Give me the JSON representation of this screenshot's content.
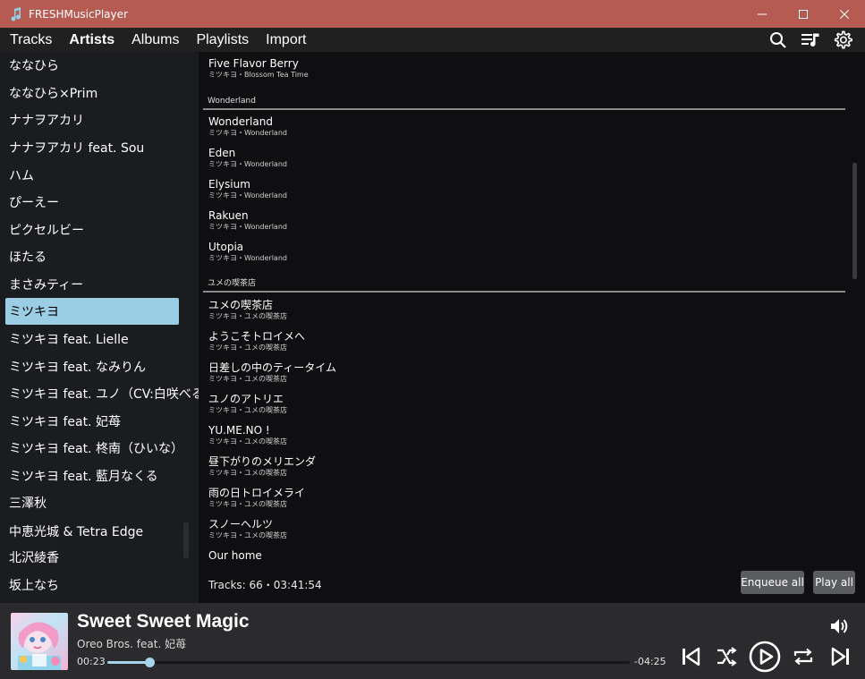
{
  "window": {
    "title": "FRESHMusicPlayer"
  },
  "nav": {
    "tabs": [
      {
        "label": "Tracks"
      },
      {
        "label": "Artists"
      },
      {
        "label": "Albums"
      },
      {
        "label": "Playlists"
      },
      {
        "label": "Import"
      }
    ],
    "active_tab": "Artists",
    "icons": [
      "search-icon",
      "queue-icon",
      "settings-icon"
    ]
  },
  "sidebar": {
    "artists": [
      "ななひら",
      "ななひら×Prim",
      "ナナヲアカリ",
      "ナナヲアカリ feat. Sou",
      "ハム",
      "ぴーえー",
      "ピクセルビー",
      "ほたる",
      "まさみティー",
      "ミツキヨ",
      "ミツキヨ feat. Lielle",
      "ミツキヨ feat. なみりん",
      "ミツキヨ feat. ユノ（CV:白咲べる）",
      "ミツキヨ feat. 妃苺",
      "ミツキヨ feat. 柊南（ひいな）",
      "ミツキヨ feat. 藍月なくる",
      "三澤秋",
      "中恵光城 & Tetra Edge",
      "北沢綾香",
      "坂上なち"
    ],
    "selected": "ミツキヨ"
  },
  "main": {
    "first_track": {
      "title": "Five Flavor Berry",
      "sub": "ミツキヨ・Blossom Tea Time"
    },
    "groups": [
      {
        "name": "Wonderland",
        "tracks": [
          {
            "title": "Wonderland",
            "sub": "ミツキヨ・Wonderland"
          },
          {
            "title": "Eden",
            "sub": "ミツキヨ・Wonderland"
          },
          {
            "title": "Elysium",
            "sub": "ミツキヨ・Wonderland"
          },
          {
            "title": "Rakuen",
            "sub": "ミツキヨ・Wonderland"
          },
          {
            "title": "Utopia",
            "sub": "ミツキヨ・Wonderland"
          }
        ]
      },
      {
        "name": "ユメの喫茶店",
        "tracks": [
          {
            "title": "ユメの喫茶店",
            "sub": "ミツキヨ・ユメの喫茶店"
          },
          {
            "title": "ようこそトロイメへ",
            "sub": "ミツキヨ・ユメの喫茶店"
          },
          {
            "title": "日差しの中のティータイム",
            "sub": "ミツキヨ・ユメの喫茶店"
          },
          {
            "title": "ユノのアトリエ",
            "sub": "ミツキヨ・ユメの喫茶店"
          },
          {
            "title": "YU.ME.NO !",
            "sub": "ミツキヨ・ユメの喫茶店"
          },
          {
            "title": "昼下がりのメリエンダ",
            "sub": "ミツキヨ・ユメの喫茶店"
          },
          {
            "title": "雨の日トロイメライ",
            "sub": "ミツキヨ・ユメの喫茶店"
          },
          {
            "title": "スノーヘルツ",
            "sub": "ミツキヨ・ユメの喫茶店"
          },
          {
            "title": "Our home",
            "sub": ""
          }
        ]
      }
    ],
    "stats": "Tracks: 66・03:41:54",
    "enqueue_label": "Enqueue all",
    "play_label": "Play all"
  },
  "player": {
    "title": "Sweet Sweet Magic",
    "artist": "Oreo Bros. feat. 妃苺",
    "time_current": "00:23",
    "time_remaining": "-04:25",
    "progress_fraction": 0.08,
    "accent_color": "#a6d4ea",
    "icons": [
      "volume-icon",
      "previous-icon",
      "shuffle-icon",
      "play-icon",
      "repeat-icon",
      "next-icon"
    ]
  }
}
